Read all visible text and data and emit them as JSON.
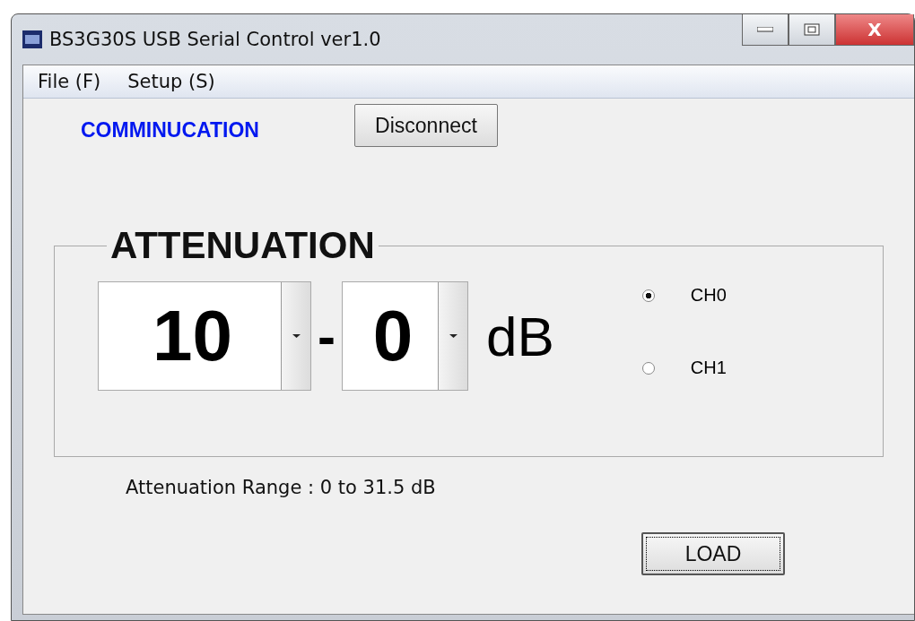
{
  "window": {
    "title": "BS3G30S USB Serial Control ver1.0",
    "close_label": "X"
  },
  "menu": [
    {
      "label": "File (F)"
    },
    {
      "label": "Setup (S)"
    }
  ],
  "communication": {
    "label": "COMMINUCATION",
    "button": "Disconnect"
  },
  "attenuation": {
    "title": "ATTENUATION",
    "combos": [
      {
        "value": "10"
      },
      {
        "value": "0"
      }
    ],
    "separator": "-",
    "unit": "dB",
    "channels": [
      {
        "label": "CH0",
        "selected": true
      },
      {
        "label": "CH1",
        "selected": false
      }
    ]
  },
  "range_text": "Attenuation Range : 0 to 31.5 dB",
  "load_button": "LOAD"
}
